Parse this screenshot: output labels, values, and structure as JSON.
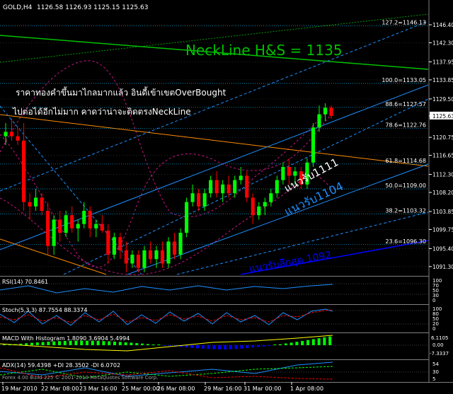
{
  "header": {
    "symbol": "GOLD,H4",
    "ohlc": "1126.58 1126.93 1125.15 1125.63"
  },
  "annotations": {
    "neckline": "NeckLine H&S = 1135",
    "note_line1": "ราคาทองคำขึ้นมาไกลมากแล้ว อินดี้เข้าเขตOverBought",
    "note_line2": "ไปต่อได้อีกไม่มาก คาดว่าน่าจะติดตรงNeckLine",
    "support_1111": "แนวรับ1111",
    "support_1104": "แนวรับ1104",
    "support_1092": "แนวรับลึกสุด 1092"
  },
  "fibo_levels": [
    {
      "label": "127.2=1146.13"
    },
    {
      "label": "100.0=1133.05"
    },
    {
      "label": "88.6=1127.57"
    },
    {
      "label": "78.6=1122.76"
    },
    {
      "label": "61.8=1114.68"
    },
    {
      "label": "50.0=1109.00"
    },
    {
      "label": "38.2=1103.32"
    },
    {
      "label": "23.6=1096.30"
    }
  ],
  "price_axis": [
    {
      "price": 1146.4,
      "label": "1146.40"
    },
    {
      "price": 1142.3,
      "label": "1142.30"
    },
    {
      "price": 1137.95,
      "label": "1137.95"
    },
    {
      "price": 1133.85,
      "label": "1133.85"
    },
    {
      "price": 1129.5,
      "label": "1129.50"
    },
    {
      "price": 1125.63,
      "label": "1125.63",
      "highlight": true
    },
    {
      "price": 1120.75,
      "label": "1120.75"
    },
    {
      "price": 1116.65,
      "label": "1116.65"
    },
    {
      "price": 1112.3,
      "label": "1112.30"
    },
    {
      "price": 1108.2,
      "label": "1108.20"
    },
    {
      "price": 1103.85,
      "label": "1103.85"
    },
    {
      "price": 1099.75,
      "label": "1099.75"
    },
    {
      "price": 1095.4,
      "label": "1095.40"
    },
    {
      "price": 1091.3,
      "label": "1091.30"
    }
  ],
  "time_axis": [
    "19 Mar 2010",
    "22 Mar 08:00",
    "23 Mar 16:00",
    "25 Mar 00:00",
    "26 Mar 08:00",
    "29 Mar 16:00",
    "31 Mar 00:00",
    "1 Apr 08:00"
  ],
  "indicators": {
    "rsi": {
      "title": "RSI(14) 70.8461",
      "axis": [
        "100",
        "70",
        "50",
        "30",
        "0"
      ]
    },
    "stoch": {
      "title": "Stoch(5,3,3) 87.7554 88.3374",
      "axis": [
        "100",
        "80",
        "50",
        "20",
        "0"
      ]
    },
    "macd": {
      "title": "MACD With Histogram 1.8090 3.6904 5.4994",
      "axis": [
        "6.1105",
        "0.00",
        "-7.3337"
      ]
    },
    "adx": {
      "title": "ADX(14) 59.4398 +DI 28.3502 -DI 6.0702",
      "axis": [
        "54",
        "30",
        "5"
      ]
    }
  },
  "watermark": "Forex 4.00 Build 225 © 2001-2010 MetaQuotes Software Corp.",
  "colors": {
    "bull": "#00ff00",
    "bear": "#ff0000",
    "neckline": "#00c000",
    "fibo": "#00bfff",
    "channel": "#1e90ff",
    "support_line": "#0000ff",
    "trend_orange": "#ff8c00",
    "bollinger": "#c71585"
  },
  "chart_data": {
    "type": "candlestick",
    "symbol": "GOLD",
    "timeframe": "H4",
    "ylim": [
      1089.5,
      1148.5
    ],
    "candles": [
      {
        "o": 1121.0,
        "h": 1124.0,
        "l": 1119.0,
        "c": 1122.0
      },
      {
        "o": 1122.0,
        "h": 1125.0,
        "l": 1120.0,
        "c": 1121.0
      },
      {
        "o": 1121.0,
        "h": 1123.0,
        "l": 1119.0,
        "c": 1120.0
      },
      {
        "o": 1120.0,
        "h": 1124.0,
        "l": 1104.0,
        "c": 1106.0
      },
      {
        "o": 1106.0,
        "h": 1108.0,
        "l": 1102.0,
        "c": 1105.0
      },
      {
        "o": 1105.0,
        "h": 1109.0,
        "l": 1104.0,
        "c": 1107.0
      },
      {
        "o": 1107.0,
        "h": 1108.0,
        "l": 1103.0,
        "c": 1104.0
      },
      {
        "o": 1104.0,
        "h": 1106.0,
        "l": 1094.0,
        "c": 1096.0
      },
      {
        "o": 1096.0,
        "h": 1103.0,
        "l": 1094.0,
        "c": 1102.0
      },
      {
        "o": 1102.0,
        "h": 1104.0,
        "l": 1097.0,
        "c": 1099.0
      },
      {
        "o": 1099.0,
        "h": 1104.0,
        "l": 1098.0,
        "c": 1103.0
      },
      {
        "o": 1103.0,
        "h": 1105.0,
        "l": 1099.0,
        "c": 1100.0
      },
      {
        "o": 1100.0,
        "h": 1102.0,
        "l": 1097.0,
        "c": 1101.0
      },
      {
        "o": 1101.0,
        "h": 1106.0,
        "l": 1100.0,
        "c": 1104.0
      },
      {
        "o": 1104.0,
        "h": 1105.0,
        "l": 1098.0,
        "c": 1100.0
      },
      {
        "o": 1100.0,
        "h": 1102.0,
        "l": 1098.0,
        "c": 1101.0
      },
      {
        "o": 1101.0,
        "h": 1103.0,
        "l": 1099.0,
        "c": 1099.5
      },
      {
        "o": 1099.5,
        "h": 1101.0,
        "l": 1092.0,
        "c": 1094.0
      },
      {
        "o": 1094.0,
        "h": 1099.0,
        "l": 1093.0,
        "c": 1098.0
      },
      {
        "o": 1098.0,
        "h": 1099.0,
        "l": 1093.0,
        "c": 1095.0
      },
      {
        "o": 1095.0,
        "h": 1097.0,
        "l": 1090.0,
        "c": 1092.0
      },
      {
        "o": 1092.0,
        "h": 1095.0,
        "l": 1091.0,
        "c": 1094.0
      },
      {
        "o": 1094.0,
        "h": 1095.0,
        "l": 1090.0,
        "c": 1091.0
      },
      {
        "o": 1091.0,
        "h": 1096.0,
        "l": 1090.0,
        "c": 1095.0
      },
      {
        "o": 1095.0,
        "h": 1097.0,
        "l": 1092.0,
        "c": 1093.0
      },
      {
        "o": 1093.0,
        "h": 1096.0,
        "l": 1091.0,
        "c": 1095.0
      },
      {
        "o": 1095.0,
        "h": 1097.0,
        "l": 1091.0,
        "c": 1092.0
      },
      {
        "o": 1092.0,
        "h": 1098.0,
        "l": 1091.0,
        "c": 1097.0
      },
      {
        "o": 1097.0,
        "h": 1099.0,
        "l": 1093.0,
        "c": 1094.0
      },
      {
        "o": 1094.0,
        "h": 1100.0,
        "l": 1093.0,
        "c": 1099.0
      },
      {
        "o": 1099.0,
        "h": 1107.0,
        "l": 1098.0,
        "c": 1106.0
      },
      {
        "o": 1106.0,
        "h": 1110.0,
        "l": 1105.0,
        "c": 1108.0
      },
      {
        "o": 1108.0,
        "h": 1109.0,
        "l": 1104.0,
        "c": 1105.0
      },
      {
        "o": 1105.0,
        "h": 1109.0,
        "l": 1104.0,
        "c": 1108.0
      },
      {
        "o": 1108.0,
        "h": 1112.0,
        "l": 1107.0,
        "c": 1111.0
      },
      {
        "o": 1111.0,
        "h": 1113.0,
        "l": 1107.0,
        "c": 1108.0
      },
      {
        "o": 1108.0,
        "h": 1111.0,
        "l": 1106.0,
        "c": 1110.0
      },
      {
        "o": 1110.0,
        "h": 1112.0,
        "l": 1107.0,
        "c": 1108.0
      },
      {
        "o": 1108.0,
        "h": 1112.0,
        "l": 1107.0,
        "c": 1111.0
      },
      {
        "o": 1111.0,
        "h": 1114.0,
        "l": 1110.0,
        "c": 1112.0
      },
      {
        "o": 1112.0,
        "h": 1113.0,
        "l": 1106.0,
        "c": 1107.0
      },
      {
        "o": 1107.0,
        "h": 1108.0,
        "l": 1101.0,
        "c": 1103.0
      },
      {
        "o": 1103.0,
        "h": 1106.0,
        "l": 1102.0,
        "c": 1105.0
      },
      {
        "o": 1105.0,
        "h": 1107.0,
        "l": 1103.0,
        "c": 1106.0
      },
      {
        "o": 1106.0,
        "h": 1109.0,
        "l": 1105.0,
        "c": 1108.0
      },
      {
        "o": 1108.0,
        "h": 1112.0,
        "l": 1107.0,
        "c": 1111.0
      },
      {
        "o": 1111.0,
        "h": 1115.0,
        "l": 1110.0,
        "c": 1114.0
      },
      {
        "o": 1114.0,
        "h": 1116.0,
        "l": 1110.0,
        "c": 1112.0
      },
      {
        "o": 1112.0,
        "h": 1114.0,
        "l": 1110.0,
        "c": 1113.0
      },
      {
        "o": 1113.0,
        "h": 1114.0,
        "l": 1109.0,
        "c": 1110.0
      },
      {
        "o": 1110.0,
        "h": 1116.0,
        "l": 1109.0,
        "c": 1115.0
      },
      {
        "o": 1115.0,
        "h": 1124.0,
        "l": 1114.0,
        "c": 1123.0
      },
      {
        "o": 1123.0,
        "h": 1128.0,
        "l": 1122.0,
        "c": 1126.0
      },
      {
        "o": 1126.0,
        "h": 1128.5,
        "l": 1124.5,
        "c": 1127.5
      },
      {
        "o": 1127.5,
        "h": 1128.0,
        "l": 1125.0,
        "c": 1125.63
      }
    ]
  }
}
